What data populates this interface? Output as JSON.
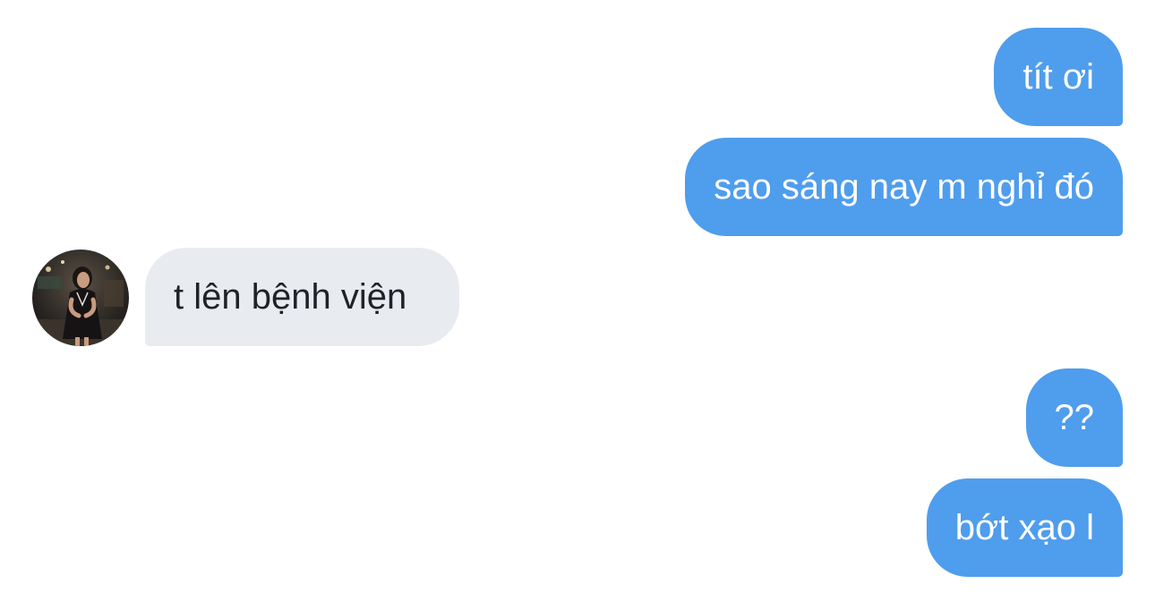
{
  "conversation": {
    "messages": [
      {
        "sender": "me",
        "text": "tít ơi"
      },
      {
        "sender": "me",
        "text": "sao sáng nay m nghỉ đó"
      },
      {
        "sender": "contact",
        "text": "t lên bệnh viện"
      },
      {
        "sender": "me",
        "text": "??"
      },
      {
        "sender": "me",
        "text": "bớt xạo l"
      }
    ]
  },
  "colors": {
    "outgoing_bubble": "#4f9ded",
    "incoming_bubble": "#e8ebf0",
    "outgoing_text": "#ffffff",
    "incoming_text": "#1f2328"
  },
  "contact": {
    "avatar_icon": "contact-avatar-photo"
  }
}
